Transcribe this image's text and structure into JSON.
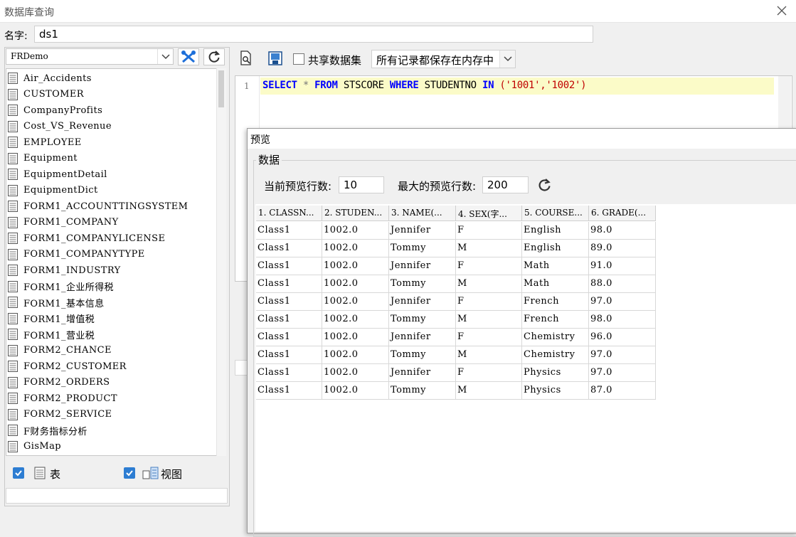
{
  "window": {
    "title": "数据库查询"
  },
  "name_field": {
    "label": "名字:",
    "value": "ds1"
  },
  "left_panel": {
    "db_select": "FRDemo",
    "tables": [
      "Air_Accidents",
      "CUSTOMER",
      "CompanyProfits",
      "Cost_VS_Revenue",
      "EMPLOYEE",
      "Equipment",
      "EquipmentDetail",
      "EquipmentDict",
      "FORM1_ACCOUNTTINGSYSTEM",
      "FORM1_COMPANY",
      "FORM1_COMPANYLICENSE",
      "FORM1_COMPANYTYPE",
      "FORM1_INDUSTRY",
      "FORM1_企业所得税",
      "FORM1_基本信息",
      "FORM1_增值税",
      "FORM1_营业税",
      "FORM2_CHANCE",
      "FORM2_CUSTOMER",
      "FORM2_ORDERS",
      "FORM2_PRODUCT",
      "FORM2_SERVICE",
      "F财务指标分析",
      "GisMap"
    ],
    "show_tables_label": "表",
    "show_views_label": "视图",
    "show_tables_checked": true,
    "show_views_checked": true
  },
  "sql_toolbar": {
    "share_label": "共享数据集",
    "share_checked": false,
    "memory_select": "所有记录都保存在内存中"
  },
  "editor": {
    "line_number": "1",
    "sql": {
      "kw_select": "SELECT",
      "star": " * ",
      "kw_from": "FROM",
      "table": " STSCORE ",
      "kw_where": "WHERE",
      "column": " STUDENTNO ",
      "kw_in": "IN",
      "args": " ('1001','1002')"
    }
  },
  "preview": {
    "title": "预览",
    "group_label": "数据",
    "current_rows_label": "当前预览行数:",
    "current_rows_value": "10",
    "max_rows_label": "最大的预览行数:",
    "max_rows_value": "200",
    "columns": [
      "1. CLASSN...",
      "2. STUDEN...",
      "3. NAME(...",
      "4. SEX(字...",
      "5. COURSE...",
      "6. GRADE(..."
    ],
    "rows": [
      [
        "Class1",
        "1002.0",
        "Jennifer",
        "F",
        "English",
        "98.0"
      ],
      [
        "Class1",
        "1002.0",
        "Tommy",
        "M",
        "English",
        "89.0"
      ],
      [
        "Class1",
        "1002.0",
        "Jennifer",
        "F",
        "Math",
        "91.0"
      ],
      [
        "Class1",
        "1002.0",
        "Tommy",
        "M",
        "Math",
        "88.0"
      ],
      [
        "Class1",
        "1002.0",
        "Jennifer",
        "F",
        "French",
        "97.0"
      ],
      [
        "Class1",
        "1002.0",
        "Tommy",
        "M",
        "French",
        "98.0"
      ],
      [
        "Class1",
        "1002.0",
        "Jennifer",
        "F",
        "Chemistry",
        "96.0"
      ],
      [
        "Class1",
        "1002.0",
        "Tommy",
        "M",
        "Chemistry",
        "97.0"
      ],
      [
        "Class1",
        "1002.0",
        "Jennifer",
        "F",
        "Physics",
        "97.0"
      ],
      [
        "Class1",
        "1002.0",
        "Tommy",
        "M",
        "Physics",
        "87.0"
      ]
    ]
  },
  "icons": {
    "close": "close-icon",
    "dropdown": "chevron-down-icon",
    "db_tools": "wrench-tools-icon",
    "refresh": "refresh-icon",
    "preview": "preview-document-icon",
    "save": "save-parameter-icon",
    "table": "table-icon",
    "view": "view-icon"
  },
  "colors": {
    "checkbox_checked": "#2d7dd2",
    "tools_icon": "#1e6fd9",
    "sql_keyword": "#0000ff",
    "sql_string": "#c00000",
    "sql_line_highlight": "#fbfbc8"
  }
}
